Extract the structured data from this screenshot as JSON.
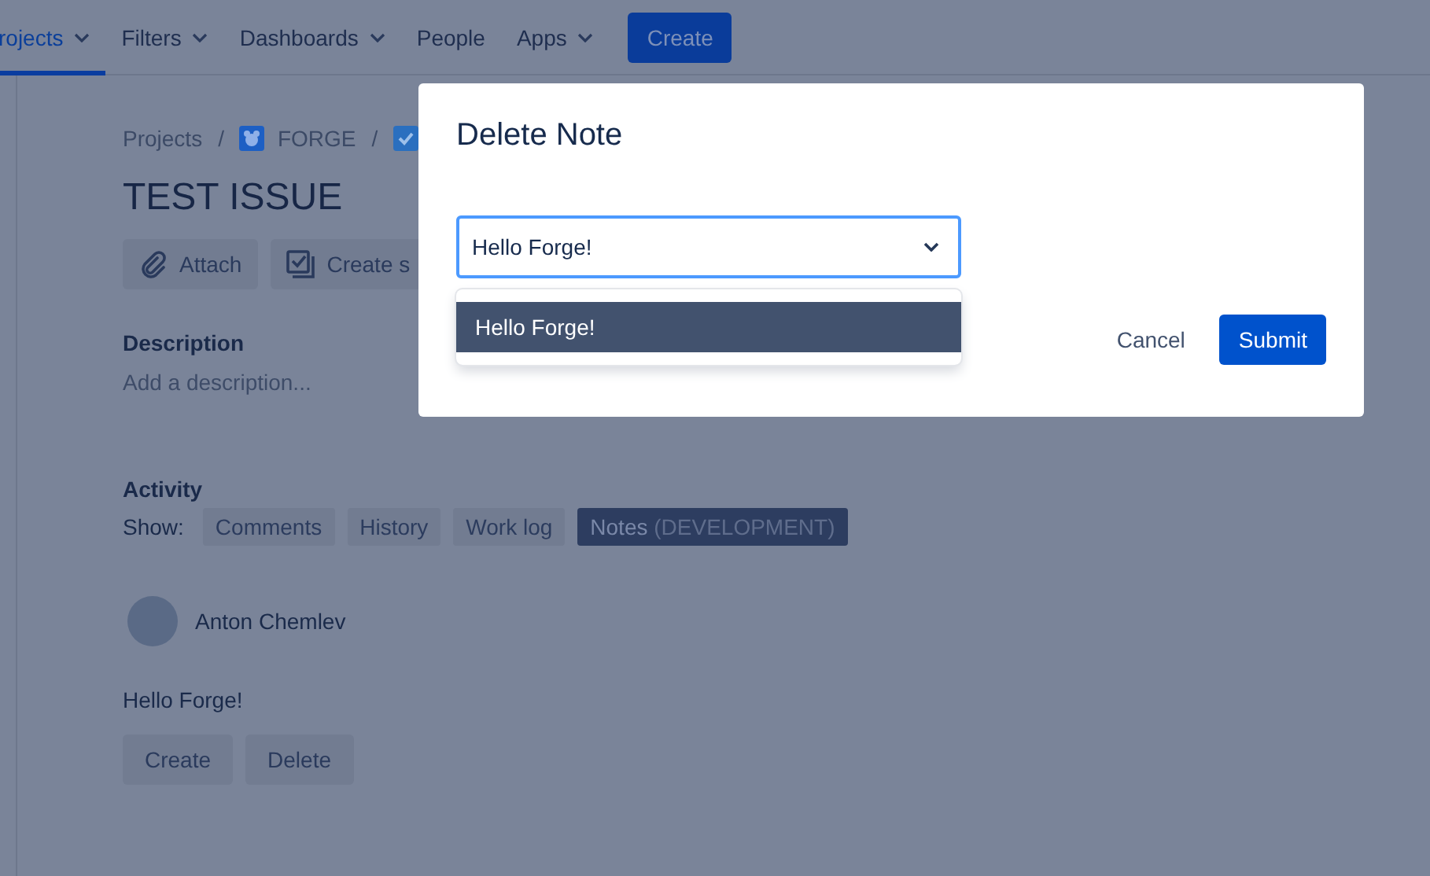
{
  "nav": {
    "items": [
      {
        "label": "rojects",
        "selected": true,
        "dropdown": true
      },
      {
        "label": "Filters",
        "selected": false,
        "dropdown": true
      },
      {
        "label": "Dashboards",
        "selected": false,
        "dropdown": true
      },
      {
        "label": "People",
        "selected": false,
        "dropdown": false
      },
      {
        "label": "Apps",
        "selected": false,
        "dropdown": true
      }
    ],
    "create_button": "Create"
  },
  "breadcrumbs": [
    {
      "label": "Projects",
      "kind": "text"
    },
    {
      "separator": "/",
      "label": "FORGE",
      "kind": "project"
    },
    {
      "separator": "/",
      "kind": "issue"
    }
  ],
  "issue": {
    "title": "TEST ISSUE",
    "actions": [
      {
        "label": "Attach",
        "kind": "attach"
      },
      {
        "label": "Create s",
        "kind": "subtask"
      }
    ],
    "description_label": "Description",
    "description_placeholder": "Add a description..."
  },
  "activity": {
    "title": "Activity",
    "show_label": "Show:",
    "filters": [
      {
        "label": "Comments",
        "selected": false
      },
      {
        "label": "History",
        "selected": false
      },
      {
        "label": "Work log",
        "selected": false
      },
      {
        "label": "Notes",
        "suffix": "(DEVELOPMENT)",
        "selected": true
      }
    ],
    "author": "Anton Chemlev",
    "note": "Hello Forge!",
    "buttons": [
      "Create",
      "Delete"
    ]
  },
  "modal": {
    "title": "Delete Note",
    "select": {
      "value": "Hello Forge!",
      "options": [
        {
          "label": "Hello Forge!",
          "selected": true
        }
      ]
    },
    "cancel": "Cancel",
    "submit": "Submit"
  }
}
